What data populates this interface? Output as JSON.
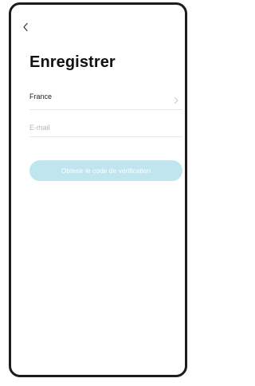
{
  "header": {
    "back_icon": "chevron-left-icon"
  },
  "main": {
    "title": "Enregistrer",
    "country": {
      "value": "France",
      "icon": "chevron-right-icon"
    },
    "email": {
      "value": "",
      "placeholder": "E-mail"
    },
    "verify_button": {
      "label": "Obtenir le code de vérification"
    }
  },
  "colors": {
    "button_background": "#bfe6ee",
    "button_text": "#ffffff",
    "divider": "#e6e6e6",
    "frame": "#1c1c1c"
  }
}
